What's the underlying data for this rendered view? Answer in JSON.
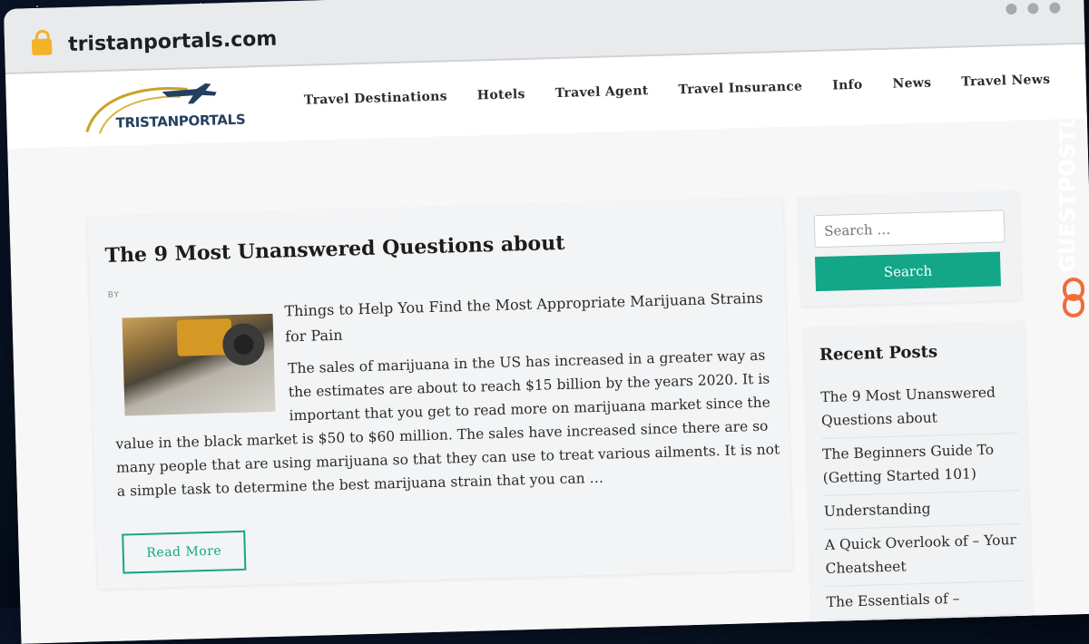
{
  "browser": {
    "url": "tristanportals.com",
    "lock_icon": "lock-icon"
  },
  "site": {
    "logo_text": "TRISTANPORTALS",
    "nav": [
      "Travel Destinations",
      "Hotels",
      "Travel Agent",
      "Travel Insurance",
      "Info",
      "News",
      "Travel News"
    ]
  },
  "post": {
    "title": "The 9 Most Unanswered Questions about",
    "byline": "BY",
    "lead": "Things to Help You Find the Most Appropriate Marijuana Strains for Pain",
    "body_first": "The sales of marijuana in the US has increased in a greater way as the estimates are about to reach $15 billion by the years 2020. It is important that you get to read more on marijuana market since the",
    "body_rest": "value in the black market is $50 to $60 million. The sales have increased since there are so many people that are using marijuana so that they can use to treat various ailments. It is not a simple task to determine the best marijuana strain that you can …",
    "read_more": "Read More"
  },
  "sidebar": {
    "search_placeholder": "Search …",
    "search_button": "Search",
    "recent_title": "Recent Posts",
    "recent_posts": [
      "The 9 Most Unanswered Questions about",
      "The Beginners Guide To (Getting Started 101)",
      "Understanding",
      "A Quick Overlook of – Your Cheatsheet",
      "The Essentials of –"
    ]
  },
  "watermark": {
    "text": "GUESTPOSTLINKS"
  },
  "colors": {
    "accent": "#13a688",
    "lock": "#f4b228",
    "watermark_icon": "#f26b3a"
  }
}
